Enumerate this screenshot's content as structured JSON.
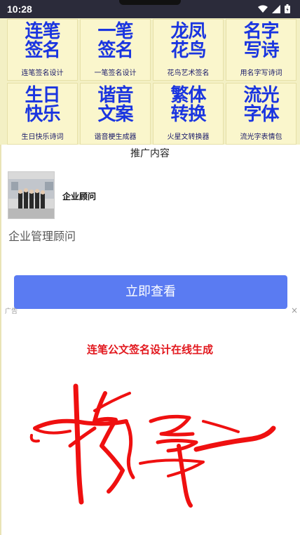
{
  "status": {
    "time": "10:28"
  },
  "tiles": [
    {
      "logo_line1": "连笔",
      "logo_line2": "签名",
      "caption": "连笔签名设计"
    },
    {
      "logo_line1": "一笔",
      "logo_line2": "签名",
      "caption": "一笔签名设计"
    },
    {
      "logo_line1": "龙凤",
      "logo_line2": "花鸟",
      "caption": "花鸟艺术签名"
    },
    {
      "logo_line1": "名字",
      "logo_line2": "写诗",
      "caption": "用名字写诗词"
    },
    {
      "logo_line1": "生日",
      "logo_line2": "快乐",
      "caption": "生日快乐诗词"
    },
    {
      "logo_line1": "谐音",
      "logo_line2": "文案",
      "caption": "谐音梗生成器"
    },
    {
      "logo_line1": "繁体",
      "logo_line2": "转换",
      "caption": "火星文转换器"
    },
    {
      "logo_line1": "流光",
      "logo_line2": "字体",
      "caption": "流光字表情包"
    }
  ],
  "ad": {
    "section_label": "推广内容",
    "name": "企业顾问",
    "description": "企业管理顾问",
    "button_label": "立即查看",
    "mark": "广告",
    "close": "×"
  },
  "hero": {
    "title": "连笔公文签名设计在线生成"
  },
  "colors": {
    "accent_blue": "#5a7bf2",
    "logo_blue": "#1a35e0",
    "title_red": "#e2181e",
    "tile_bg": "#faf6cc"
  }
}
